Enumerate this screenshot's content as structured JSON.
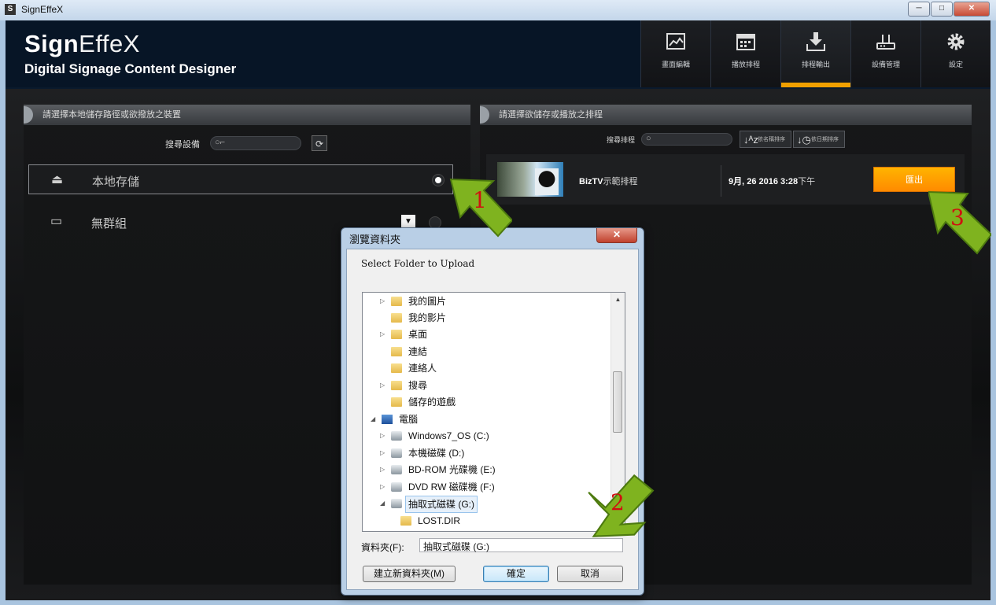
{
  "window": {
    "title": "SignEffeX",
    "controls": [
      "─",
      "□",
      "✕"
    ]
  },
  "app": {
    "brand_bold": "Sign",
    "brand_light": "EffeX",
    "subtitle": "Digital Signage Content Designer"
  },
  "nav": [
    {
      "label": "畫面編輯",
      "icon": "image-editor-icon"
    },
    {
      "label": "播放排程",
      "icon": "calendar-icon"
    },
    {
      "label": "排程輸出",
      "icon": "download-icon",
      "active": true
    },
    {
      "label": "設備管理",
      "icon": "router-icon"
    },
    {
      "label": "設定",
      "icon": "gear-icon"
    }
  ],
  "left_panel": {
    "header": "請選擇本地儲存路徑或欲撥放之裝置",
    "search_label": "搜尋設備",
    "items": [
      {
        "label": "本地存儲",
        "selected": true
      },
      {
        "label": "無群組",
        "selected": false
      }
    ]
  },
  "right_panel": {
    "header": "請選擇欲儲存或播放之排程",
    "search_label": "搜尋排程",
    "sort_name": "依名稱排序",
    "sort_date": "依日期排序",
    "schedule": {
      "name_bold": "BizTV",
      "name_rest": "示範排程",
      "date_bold": "9月, 26 2016 3:28",
      "date_rest": "下午",
      "export_label": "匯出"
    }
  },
  "dialog": {
    "title": "瀏覽資料夾",
    "close": "✕",
    "description": "Select Folder to Upload",
    "tree": [
      {
        "label": "我的圖片",
        "arrow": "▷"
      },
      {
        "label": "我的影片",
        "arrow": ""
      },
      {
        "label": "桌面",
        "arrow": "▷"
      },
      {
        "label": "連結",
        "arrow": ""
      },
      {
        "label": "連絡人",
        "arrow": ""
      },
      {
        "label": "搜尋",
        "arrow": "▷"
      },
      {
        "label": "儲存的遊戲",
        "arrow": ""
      },
      {
        "label": "電腦",
        "arrow": "◢"
      },
      {
        "label": "Windows7_OS (C:)",
        "arrow": "▷"
      },
      {
        "label": "本機磁碟 (D:)",
        "arrow": "▷"
      },
      {
        "label": "BD-ROM 光碟機 (E:)",
        "arrow": "▷"
      },
      {
        "label": "DVD RW 磁碟機 (F:)",
        "arrow": "▷"
      },
      {
        "label": "抽取式磁碟 (G:)",
        "arrow": "◢",
        "selected": true
      },
      {
        "label": "LOST.DIR",
        "arrow": ""
      }
    ],
    "folder_label": "資料夾(F):",
    "folder_value": "抽取式磁碟 (G:)",
    "new_folder": "建立新資料夾(M)",
    "ok": "確定",
    "cancel": "取消"
  },
  "callouts": [
    "1",
    "2",
    "3"
  ],
  "colors": {
    "accent": "#f0a000",
    "export": "#ff9a00",
    "callout_green": "#7fb31f"
  }
}
